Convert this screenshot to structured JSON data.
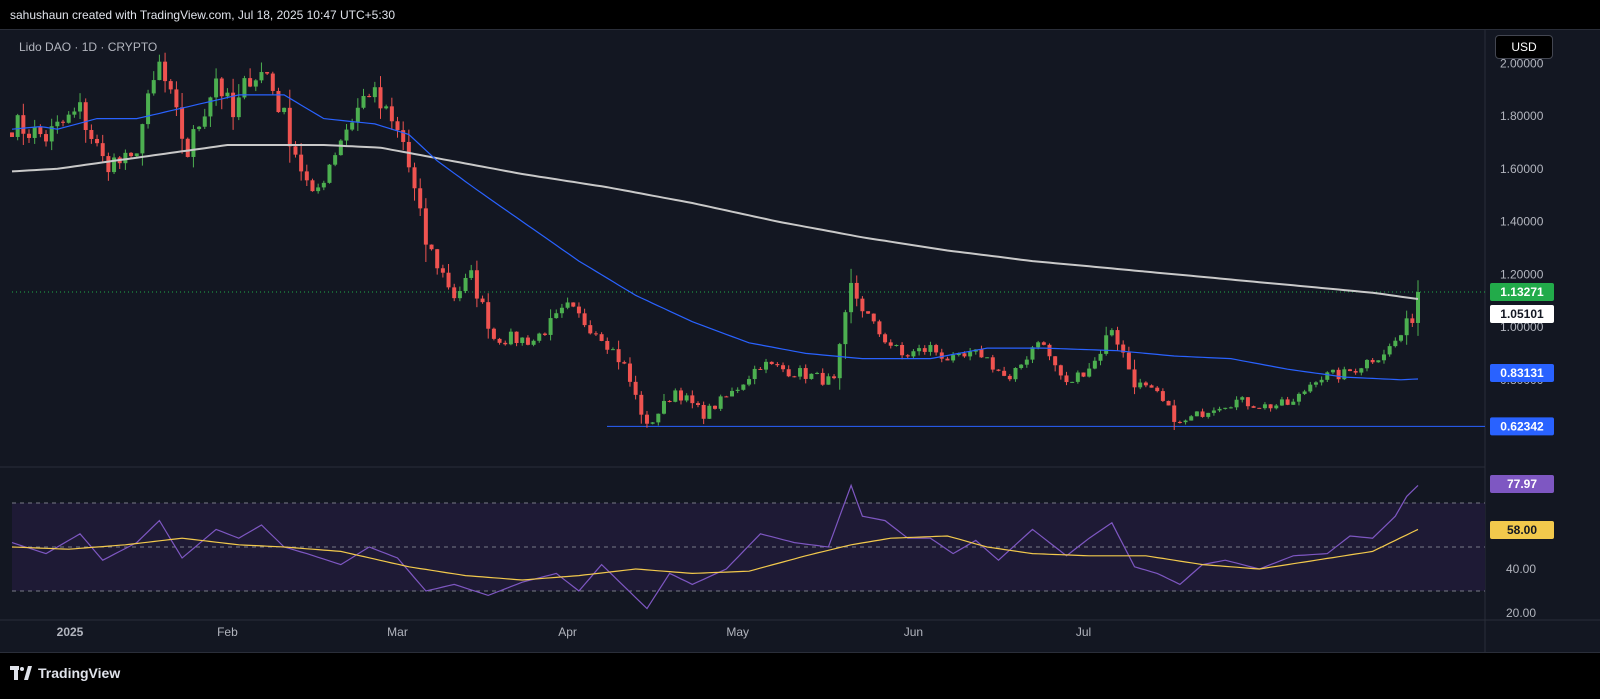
{
  "header": {
    "text": "sahushaun created with TradingView.com, Jul 18, 2025 10:47 UTC+5:30"
  },
  "symbol": {
    "label": "Lido DAO · 1D · CRYPTO"
  },
  "currency": "USD",
  "footer": {
    "brand": "TradingView",
    "logo_icon": "tradingview-logo-icon"
  },
  "colors": {
    "background": "#131722",
    "up": "#26a69a",
    "up_bright": "#4caf50",
    "down": "#ef5350",
    "ma_long": "#c9c9c9",
    "ma_short": "#2962ff",
    "rsi_line": "#7e57c2",
    "rsi_ma": "#f2c94c",
    "rsi_band": "#1e1a35",
    "support": "#2962ff",
    "last_price_label": "#22ab4a"
  },
  "chart_data": [
    {
      "type": "candlestick",
      "price_axis": {
        "ticks": [
          "1.80000",
          "1.60000",
          "1.40000",
          "1.20000",
          "1.00000",
          "0.80000"
        ],
        "tick_values": [
          1.8,
          1.6,
          1.4,
          1.2,
          1.0,
          0.8
        ],
        "ylim": [
          0.55,
          2.05
        ]
      },
      "time_axis": {
        "labels": [
          "2025",
          "Feb",
          "Mar",
          "Apr",
          "May",
          "Jun",
          "Jul"
        ]
      },
      "price_labels": [
        {
          "value": "1.13271",
          "series": "last price"
        },
        {
          "value": "1.05101",
          "series": "MA long"
        },
        {
          "value": "0.83131",
          "series": "MA short"
        },
        {
          "value": "0.62342",
          "series": "support line"
        }
      ],
      "support_level": 0.62342,
      "last_price": 1.13271,
      "ma_long": [
        [
          0,
          1.59
        ],
        [
          8,
          1.6
        ],
        [
          18,
          1.63
        ],
        [
          28,
          1.66
        ],
        [
          38,
          1.69
        ],
        [
          45,
          1.69
        ],
        [
          55,
          1.69
        ],
        [
          65,
          1.68
        ],
        [
          75,
          1.64
        ],
        [
          90,
          1.58
        ],
        [
          105,
          1.53
        ],
        [
          120,
          1.47
        ],
        [
          135,
          1.4
        ],
        [
          150,
          1.34
        ],
        [
          165,
          1.29
        ],
        [
          180,
          1.25
        ],
        [
          195,
          1.22
        ],
        [
          210,
          1.19
        ],
        [
          225,
          1.16
        ],
        [
          240,
          1.13
        ],
        [
          250,
          1.1
        ],
        [
          262,
          1.07
        ],
        [
          268,
          1.05
        ]
      ],
      "ma_short": [
        [
          0,
          1.75
        ],
        [
          5,
          1.76
        ],
        [
          8,
          1.75
        ],
        [
          15,
          1.79
        ],
        [
          22,
          1.79
        ],
        [
          32,
          1.84
        ],
        [
          40,
          1.88
        ],
        [
          48,
          1.88
        ],
        [
          55,
          1.79
        ],
        [
          64,
          1.77
        ],
        [
          70,
          1.73
        ],
        [
          75,
          1.63
        ],
        [
          82,
          1.52
        ],
        [
          90,
          1.4
        ],
        [
          100,
          1.25
        ],
        [
          110,
          1.12
        ],
        [
          120,
          1.02
        ],
        [
          130,
          0.94
        ],
        [
          140,
          0.9
        ],
        [
          150,
          0.88
        ],
        [
          162,
          0.88
        ],
        [
          172,
          0.92
        ],
        [
          182,
          0.92
        ],
        [
          195,
          0.91
        ],
        [
          205,
          0.89
        ],
        [
          215,
          0.88
        ],
        [
          225,
          0.84
        ],
        [
          235,
          0.81
        ],
        [
          245,
          0.8
        ],
        [
          255,
          0.81
        ],
        [
          262,
          0.82
        ],
        [
          268,
          0.83
        ]
      ],
      "keypoints": [
        [
          0,
          1.77
        ],
        [
          6,
          1.72
        ],
        [
          12,
          1.82
        ],
        [
          16,
          1.63
        ],
        [
          21,
          1.62
        ],
        [
          26,
          1.99
        ],
        [
          31,
          1.66
        ],
        [
          36,
          1.95
        ],
        [
          39,
          1.79
        ],
        [
          42,
          1.96
        ],
        [
          45,
          1.96
        ],
        [
          48,
          1.79
        ],
        [
          53,
          1.48
        ],
        [
          58,
          1.72
        ],
        [
          63,
          1.9
        ],
        [
          69,
          1.7
        ],
        [
          73,
          1.32
        ],
        [
          78,
          1.12
        ],
        [
          81,
          1.19
        ],
        [
          85,
          0.96
        ],
        [
          92,
          0.95
        ],
        [
          98,
          1.07
        ],
        [
          104,
          0.97
        ],
        [
          108,
          0.85
        ],
        [
          112,
          0.62
        ],
        [
          117,
          0.76
        ],
        [
          122,
          0.67
        ],
        [
          127,
          0.75
        ],
        [
          132,
          0.86
        ],
        [
          140,
          0.82
        ],
        [
          145,
          0.79
        ],
        [
          148,
          1.15
        ],
        [
          152,
          1.0
        ],
        [
          157,
          0.89
        ],
        [
          162,
          0.92
        ],
        [
          166,
          0.87
        ],
        [
          171,
          0.9
        ],
        [
          176,
          0.79
        ],
        [
          181,
          0.96
        ],
        [
          186,
          0.78
        ],
        [
          191,
          0.87
        ],
        [
          194,
          1.0
        ],
        [
          198,
          0.79
        ],
        [
          202,
          0.74
        ],
        [
          206,
          0.63
        ],
        [
          212,
          0.7
        ],
        [
          216,
          0.72
        ],
        [
          221,
          0.7
        ],
        [
          226,
          0.71
        ],
        [
          230,
          0.81
        ],
        [
          235,
          0.82
        ],
        [
          239,
          0.87
        ],
        [
          243,
          0.92
        ],
        [
          245,
          0.97
        ],
        [
          247,
          1.04
        ],
        [
          248,
          1.13
        ]
      ],
      "n_candles": 249
    },
    {
      "type": "line",
      "name": "RSI",
      "axis": {
        "ticks": [
          "40.00",
          "20.00"
        ],
        "tick_values": [
          40,
          20
        ],
        "ylim": [
          17,
          80
        ]
      },
      "bands": {
        "upper": 70,
        "middle": 50,
        "lower": 30
      },
      "labels": [
        {
          "value": "77.97",
          "series": "RSI"
        },
        {
          "value": "58.00",
          "series": "RSI MA"
        }
      ],
      "rsi": [
        [
          0,
          52
        ],
        [
          6,
          47
        ],
        [
          12,
          56
        ],
        [
          16,
          44
        ],
        [
          22,
          52
        ],
        [
          26,
          62
        ],
        [
          30,
          45
        ],
        [
          36,
          58
        ],
        [
          40,
          54
        ],
        [
          44,
          60
        ],
        [
          48,
          50
        ],
        [
          52,
          47
        ],
        [
          58,
          42
        ],
        [
          63,
          50
        ],
        [
          68,
          45
        ],
        [
          73,
          30
        ],
        [
          78,
          33
        ],
        [
          84,
          28
        ],
        [
          90,
          34
        ],
        [
          96,
          38
        ],
        [
          100,
          30
        ],
        [
          104,
          42
        ],
        [
          108,
          32
        ],
        [
          112,
          22
        ],
        [
          116,
          38
        ],
        [
          120,
          33
        ],
        [
          126,
          40
        ],
        [
          132,
          56
        ],
        [
          138,
          52
        ],
        [
          144,
          50
        ],
        [
          148,
          78
        ],
        [
          150,
          64
        ],
        [
          154,
          62
        ],
        [
          158,
          54
        ],
        [
          162,
          54
        ],
        [
          166,
          47
        ],
        [
          170,
          53
        ],
        [
          174,
          44
        ],
        [
          180,
          58
        ],
        [
          186,
          46
        ],
        [
          190,
          54
        ],
        [
          194,
          61
        ],
        [
          198,
          41
        ],
        [
          202,
          38
        ],
        [
          206,
          33
        ],
        [
          210,
          42
        ],
        [
          214,
          44
        ],
        [
          220,
          40
        ],
        [
          226,
          46
        ],
        [
          232,
          47
        ],
        [
          236,
          55
        ],
        [
          240,
          54
        ],
        [
          244,
          64
        ],
        [
          246,
          73
        ],
        [
          248,
          78
        ]
      ],
      "rsi_ma": [
        [
          0,
          50
        ],
        [
          10,
          49
        ],
        [
          20,
          51
        ],
        [
          30,
          54
        ],
        [
          40,
          51
        ],
        [
          48,
          50
        ],
        [
          58,
          48
        ],
        [
          70,
          41
        ],
        [
          80,
          37
        ],
        [
          90,
          35
        ],
        [
          100,
          37
        ],
        [
          110,
          40
        ],
        [
          120,
          38
        ],
        [
          130,
          39
        ],
        [
          140,
          46
        ],
        [
          148,
          51
        ],
        [
          155,
          54
        ],
        [
          165,
          55
        ],
        [
          172,
          50
        ],
        [
          180,
          47
        ],
        [
          190,
          46
        ],
        [
          200,
          46
        ],
        [
          210,
          42
        ],
        [
          220,
          40
        ],
        [
          230,
          44
        ],
        [
          240,
          48
        ],
        [
          248,
          58
        ]
      ]
    }
  ]
}
